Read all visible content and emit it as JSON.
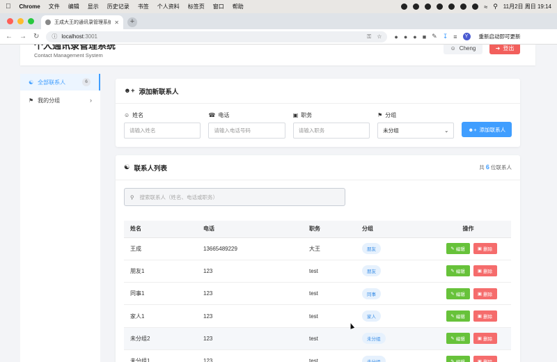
{
  "menubar": {
    "app": "Chrome",
    "items": [
      "文件",
      "编辑",
      "显示",
      "历史记录",
      "书签",
      "个人资料",
      "标签页",
      "窗口",
      "帮助"
    ],
    "datetime": "11月2日 周日  19:14"
  },
  "browser": {
    "tab_title": "王成大王的通讯录管理系统",
    "url_host": "localhost",
    "url_port": ":3001",
    "profile_initial": "Y",
    "restart_label": "重新启动即可更新"
  },
  "header": {
    "title": "个人通讯录管理系统",
    "subtitle": "Contact Management System",
    "user": "Cheng",
    "logout": "登出"
  },
  "sidebar": {
    "items": [
      {
        "label": "全部联系人",
        "count": "6"
      },
      {
        "label": "我的分组"
      }
    ]
  },
  "add_form": {
    "title": "添加新联系人",
    "fields": [
      {
        "label": "姓名",
        "placeholder": "请输入姓名"
      },
      {
        "label": "电话",
        "placeholder": "请输入电话号码"
      },
      {
        "label": "职务",
        "placeholder": "请输入职务"
      },
      {
        "label": "分组",
        "value": "未分组"
      }
    ],
    "submit": "添加联系人"
  },
  "list": {
    "title": "联系人列表",
    "count_prefix": "共",
    "count": "6",
    "count_suffix": "位联系人",
    "search_placeholder": "搜索联系人（姓名、电话或职务）",
    "columns": [
      "姓名",
      "电话",
      "职务",
      "分组",
      "操作"
    ],
    "edit_label": "编辑",
    "delete_label": "删除",
    "rows": [
      {
        "name": "王成",
        "phone": "13665489229",
        "title": "大王",
        "group": "朋友"
      },
      {
        "name": "朋友1",
        "phone": "123",
        "title": "test",
        "group": "朋友"
      },
      {
        "name": "同事1",
        "phone": "123",
        "title": "test",
        "group": "同事"
      },
      {
        "name": "家人1",
        "phone": "123",
        "title": "test",
        "group": "家人"
      },
      {
        "name": "未分组2",
        "phone": "123",
        "title": "test",
        "group": "未分组"
      },
      {
        "name": "未分组1",
        "phone": "123",
        "title": "test",
        "group": "未分组"
      }
    ]
  },
  "colors": {
    "primary": "#409eff",
    "success": "#67c23a",
    "danger": "#f56c6c",
    "logout": "#f25f5c"
  }
}
